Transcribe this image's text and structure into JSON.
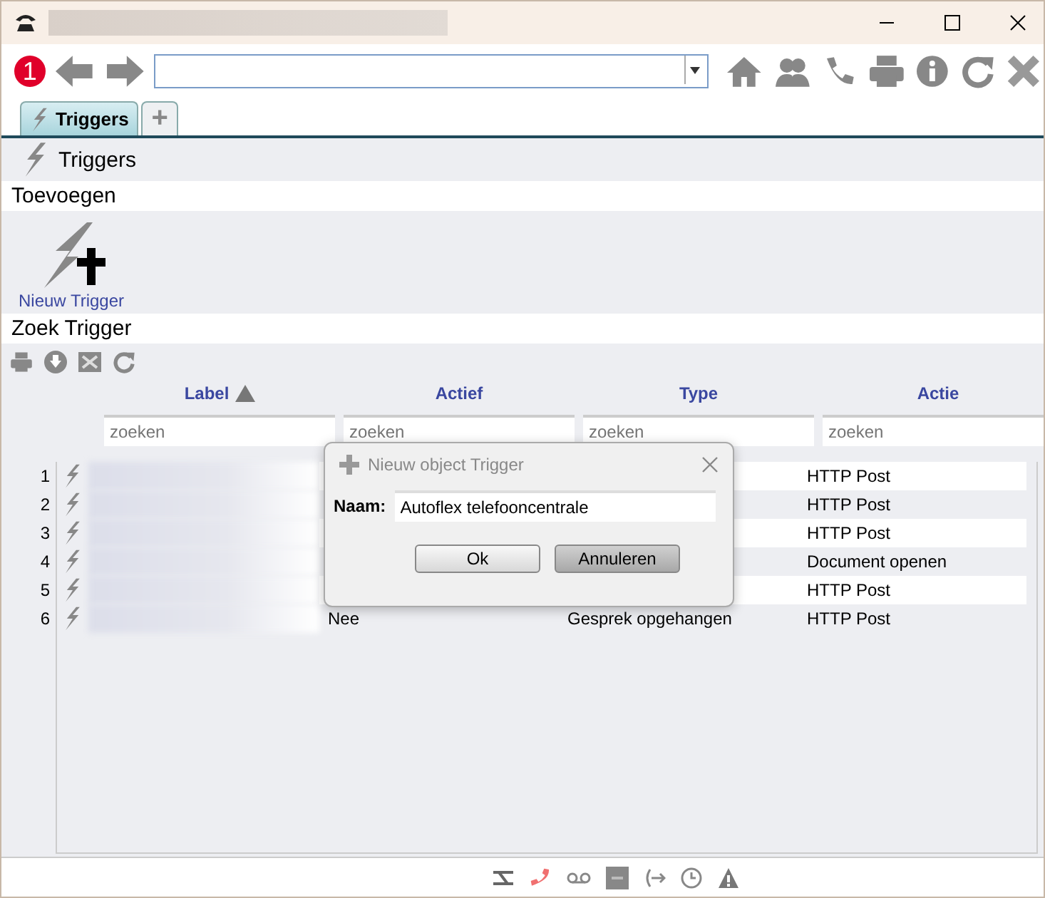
{
  "window": {
    "title_redacted": true
  },
  "toolbar": {
    "notification_badge": "1"
  },
  "tabs": [
    {
      "label": "Triggers",
      "selected": true,
      "kind": "text"
    },
    {
      "label": "+",
      "selected": false,
      "kind": "add"
    }
  ],
  "page_title": "Triggers",
  "sections": [
    {
      "title": "Toevoegen"
    },
    {
      "title": "Zoek Trigger"
    }
  ],
  "new_button": {
    "label": "Nieuw Trigger"
  },
  "table": {
    "columns": [
      {
        "label": "Label",
        "sorted": true
      },
      {
        "label": "Actief",
        "sorted": false
      },
      {
        "label": "Type",
        "sorted": false
      },
      {
        "label": "Actie",
        "sorted": false
      }
    ],
    "search_placeholders": [
      "zoeken",
      "zoeken",
      "zoeken",
      "zoeken"
    ],
    "rows": [
      {
        "number": "1",
        "actie": "HTTP Post"
      },
      {
        "number": "2",
        "actie": "HTTP Post"
      },
      {
        "number": "3",
        "actie": "HTTP Post"
      },
      {
        "number": "4",
        "actie": "Document openen"
      },
      {
        "number": "5",
        "actie": "HTTP Post"
      },
      {
        "number": "6",
        "actief": "Nee",
        "type": "Gesprek opgehangen",
        "actie": "HTTP Post"
      }
    ]
  },
  "dialog": {
    "title": "Nieuw object Trigger",
    "field_label": "Naam:",
    "field_value": "Autoflex telefooncentrale",
    "buttons": [
      {
        "label": "Ok",
        "kind": "default"
      },
      {
        "label": "Annuleren",
        "kind": "cancel"
      }
    ]
  }
}
